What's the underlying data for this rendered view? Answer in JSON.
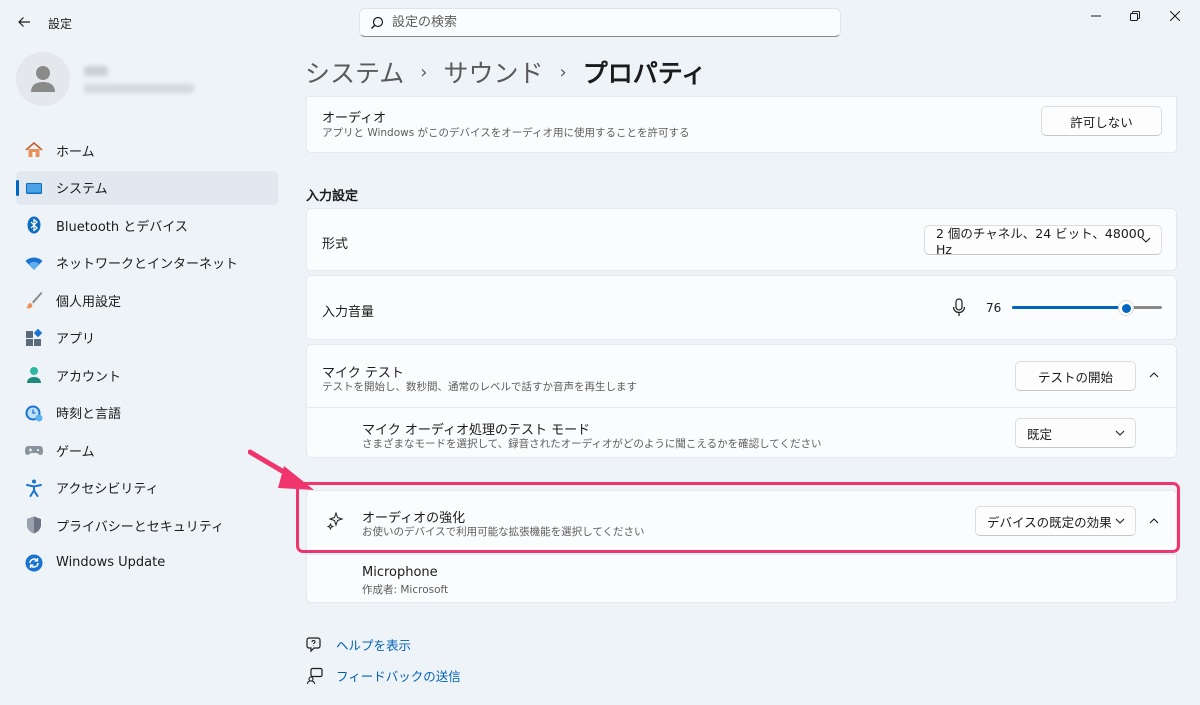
{
  "window": {
    "app_title": "設定",
    "search_placeholder": "設定の検索"
  },
  "sidebar": {
    "items": [
      {
        "label": "ホーム",
        "icon": "home-icon"
      },
      {
        "label": "システム",
        "icon": "system-icon",
        "active": true
      },
      {
        "label": "Bluetooth とデバイス",
        "icon": "bluetooth-icon"
      },
      {
        "label": "ネットワークとインターネット",
        "icon": "wifi-icon"
      },
      {
        "label": "個人用設定",
        "icon": "brush-icon"
      },
      {
        "label": "アプリ",
        "icon": "apps-icon"
      },
      {
        "label": "アカウント",
        "icon": "account-icon"
      },
      {
        "label": "時刻と言語",
        "icon": "time-language-icon"
      },
      {
        "label": "ゲーム",
        "icon": "gamepad-icon"
      },
      {
        "label": "アクセシビリティ",
        "icon": "accessibility-icon"
      },
      {
        "label": "プライバシーとセキュリティ",
        "icon": "shield-icon"
      },
      {
        "label": "Windows Update",
        "icon": "update-icon"
      }
    ]
  },
  "breadcrumb": {
    "parts": [
      "システム",
      "サウンド"
    ],
    "current": "プロパティ"
  },
  "audio_card": {
    "title": "オーディオ",
    "subtitle": "アプリと Windows がこのデバイスをオーディオ用に使用することを許可する",
    "button": "許可しない"
  },
  "input_settings": {
    "heading": "入力設定",
    "format": {
      "label": "形式",
      "value": "2 個のチャネル、24 ビット、48000 Hz"
    },
    "volume": {
      "label": "入力音量",
      "value": "76",
      "level": 76
    },
    "mic_test": {
      "title": "マイク テスト",
      "subtitle": "テストを開始し、数秒間、通常のレベルで話すか音声を再生します",
      "button": "テストの開始",
      "mode_title": "マイク オーディオ処理のテスト モード",
      "mode_subtitle": "さまざまなモードを選択して、録音されたオーディオがどのように聞こえるかを確認してください",
      "mode_value": "既定"
    },
    "enhancements": {
      "title": "オーディオの強化",
      "subtitle": "お使いのデバイスで利用可能な拡張機能を選択してください",
      "value": "デバイスの既定の効果",
      "provider_name": "Microphone",
      "provider_author": "作成者: Microsoft"
    }
  },
  "footer_links": {
    "help": "ヘルプを表示",
    "feedback": "フィードバックの送信"
  },
  "colors": {
    "accent": "#0067c0",
    "highlight": "#f0356d",
    "link": "#0060b8"
  }
}
